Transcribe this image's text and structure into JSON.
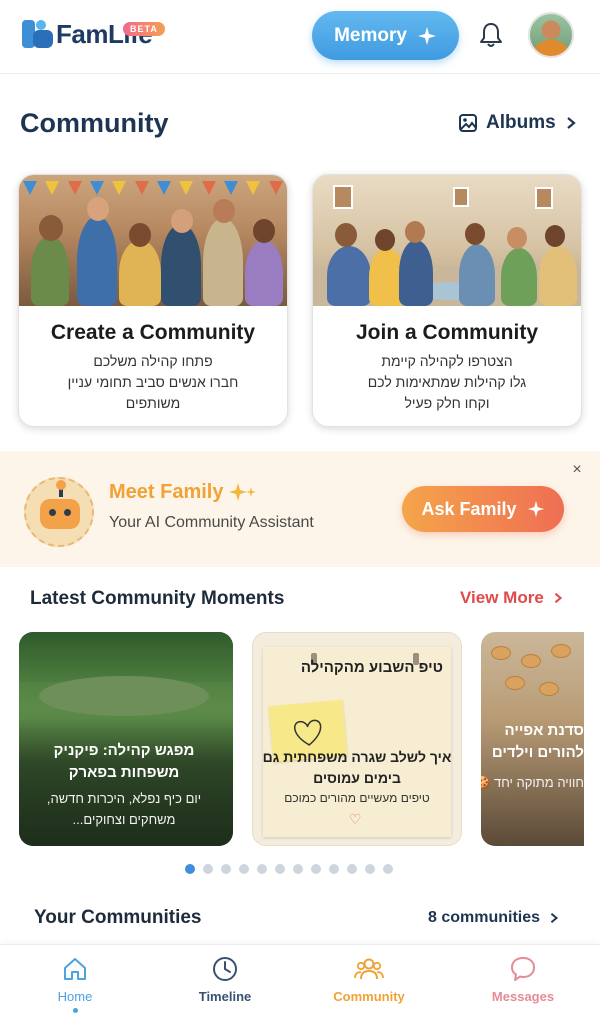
{
  "header": {
    "logo_text": "FamLife",
    "beta_label": "BETA",
    "memory_button": "Memory"
  },
  "community": {
    "title": "Community",
    "albums_label": "Albums",
    "cards": [
      {
        "title": "Create a Community",
        "lines": [
          "פתחו קהילה משלכם",
          "חברו אנשים סביב תחומי עניין",
          "משותפים"
        ]
      },
      {
        "title": "Join a Community",
        "lines": [
          "הצטרפו לקהילה קיימת",
          "גלו קהילות שמתאימות לכם",
          "וקחו חלק פעיל"
        ]
      }
    ]
  },
  "assistant_banner": {
    "title": "Meet Family",
    "subtitle": "Your AI Community Assistant",
    "button": "Ask Family",
    "close": "×"
  },
  "moments": {
    "title": "Latest Community Moments",
    "view_more": "View More",
    "items": [
      {
        "title": "מפגש קהילה: פיקניק משפחות בפארק",
        "description": "יום כיף נפלא, היכרות חדשה, משחקים וצחוקים..."
      },
      {
        "tag": "טיפ השבוע מהקהילה",
        "title": "איך לשלב שגרה משפחתית גם בימים עמוסים",
        "description": "טיפים מעשיים מהורים כמוכם"
      },
      {
        "title": "סדנת אפייה להורים וילדים",
        "description": "חוויה מתוקה יחד 🍪!"
      }
    ],
    "pagination": {
      "total": 12,
      "active": 1
    }
  },
  "your_communities": {
    "title": "Your Communities",
    "count_label": "8 communities"
  },
  "bottom_nav": [
    {
      "label": "Home",
      "color": "#4ba3e0",
      "active": true
    },
    {
      "label": "Timeline",
      "color": "#3a5170"
    },
    {
      "label": "Community",
      "color": "#f0a236"
    },
    {
      "label": "Messages",
      "color": "#e58b96"
    }
  ]
}
